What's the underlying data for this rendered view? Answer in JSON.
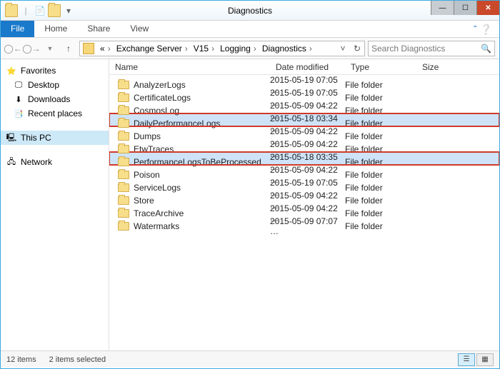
{
  "window": {
    "title": "Diagnostics",
    "qat": [
      "folder-icon",
      "document-icon",
      "folder-open-icon",
      "overflow-icon"
    ]
  },
  "ribbon": {
    "tabs": [
      "File",
      "Home",
      "Share",
      "View"
    ]
  },
  "nav": {
    "breadcrumbs": [
      "«",
      "Exchange Server",
      "V15",
      "Logging",
      "Diagnostics"
    ],
    "search_placeholder": "Search Diagnostics"
  },
  "sidebar": {
    "favorites": {
      "label": "Favorites",
      "icon": "⭐"
    },
    "fav_items": [
      {
        "label": "Desktop",
        "icon": "🖵"
      },
      {
        "label": "Downloads",
        "icon": "⬇"
      },
      {
        "label": "Recent places",
        "icon": "📑"
      }
    ],
    "thispc": {
      "label": "This PC",
      "icon": "🖳",
      "selected": true
    },
    "network": {
      "label": "Network",
      "icon": "🖧"
    }
  },
  "columns": {
    "name": "Name",
    "date": "Date modified",
    "type": "Type",
    "size": "Size"
  },
  "items": [
    {
      "name": "AnalyzerLogs",
      "date": "2015-05-19 07:05 …",
      "type": "File folder",
      "size": "",
      "sel": false,
      "hl": false
    },
    {
      "name": "CertificateLogs",
      "date": "2015-05-19 07:05 …",
      "type": "File folder",
      "size": "",
      "sel": false,
      "hl": false
    },
    {
      "name": "CosmosLog",
      "date": "2015-05-09 04:22 …",
      "type": "File folder",
      "size": "",
      "sel": false,
      "hl": false
    },
    {
      "name": "DailyPerformanceLogs",
      "date": "2015-05-18 03:34 …",
      "type": "File folder",
      "size": "",
      "sel": true,
      "hl": true
    },
    {
      "name": "Dumps",
      "date": "2015-05-09 04:22 …",
      "type": "File folder",
      "size": "",
      "sel": false,
      "hl": false
    },
    {
      "name": "EtwTraces",
      "date": "2015-05-09 04:22 …",
      "type": "File folder",
      "size": "",
      "sel": false,
      "hl": false
    },
    {
      "name": "PerformanceLogsToBeProcessed",
      "date": "2015-05-18 03:35 …",
      "type": "File folder",
      "size": "",
      "sel": true,
      "hl": true
    },
    {
      "name": "Poison",
      "date": "2015-05-09 04:22 …",
      "type": "File folder",
      "size": "",
      "sel": false,
      "hl": false
    },
    {
      "name": "ServiceLogs",
      "date": "2015-05-19 07:05 …",
      "type": "File folder",
      "size": "",
      "sel": false,
      "hl": false
    },
    {
      "name": "Store",
      "date": "2015-05-09 04:22 …",
      "type": "File folder",
      "size": "",
      "sel": false,
      "hl": false
    },
    {
      "name": "TraceArchive",
      "date": "2015-05-09 04:22 …",
      "type": "File folder",
      "size": "",
      "sel": false,
      "hl": false
    },
    {
      "name": "Watermarks",
      "date": "2015-05-09 07:07 …",
      "type": "File folder",
      "size": "",
      "sel": false,
      "hl": false
    }
  ],
  "status": {
    "count": "12 items",
    "selection": "2 items selected"
  }
}
